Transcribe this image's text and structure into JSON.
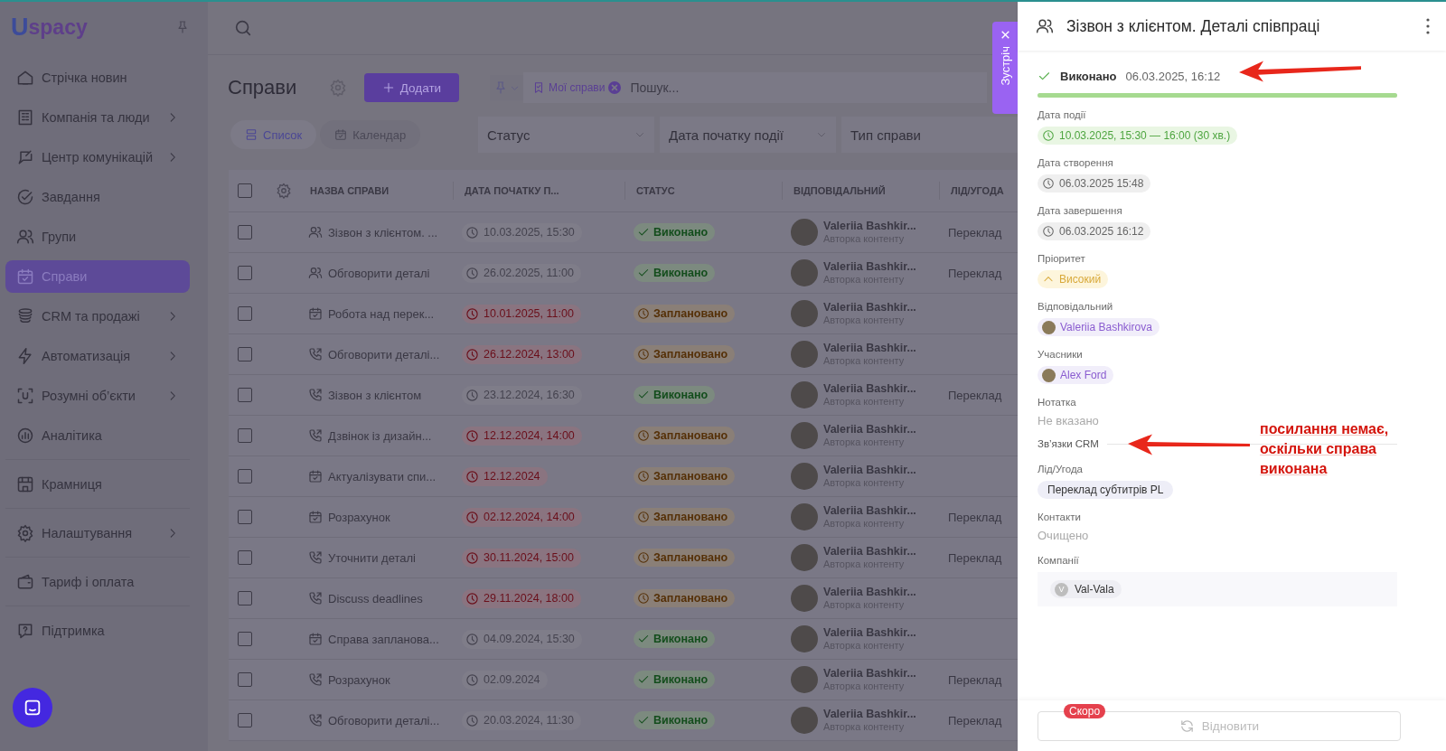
{
  "sidebar": {
    "logo": {
      "letter": "U",
      "text": "spacy"
    },
    "groups": [
      [
        {
          "label": "Стрічка новин",
          "submenu": false,
          "selected": false
        },
        {
          "label": "Компанія та люди",
          "submenu": true,
          "selected": false
        },
        {
          "label": "Центр комунікацій",
          "submenu": true,
          "selected": false
        },
        {
          "label": "Завдання",
          "submenu": false,
          "selected": false
        },
        {
          "label": "Групи",
          "submenu": false,
          "selected": false
        },
        {
          "label": "Справи",
          "submenu": false,
          "selected": true
        },
        {
          "label": "CRM та продажі",
          "submenu": true,
          "selected": false
        },
        {
          "label": "Автоматизація",
          "submenu": true,
          "selected": false
        },
        {
          "label": "Розумні об’єкти",
          "submenu": true,
          "selected": false
        },
        {
          "label": "Аналітика",
          "submenu": false,
          "selected": false
        }
      ],
      [
        {
          "label": "Крамниця",
          "submenu": false,
          "selected": false
        }
      ],
      [
        {
          "label": "Налаштування",
          "submenu": true,
          "selected": false
        }
      ],
      [
        {
          "label": "Тариф і оплата",
          "submenu": false,
          "selected": false
        }
      ],
      [
        {
          "label": "Підтримка",
          "submenu": false,
          "selected": false
        }
      ]
    ]
  },
  "page": {
    "title": "Справи",
    "add_button": "Додати",
    "filter_chip": "Мої справи",
    "search_placeholder": "Пошук...",
    "view_tabs": [
      {
        "label": "Список",
        "selected": true
      },
      {
        "label": "Календар",
        "selected": false
      }
    ],
    "filters": [
      {
        "label": "Статус",
        "dropdown": true
      },
      {
        "label": "Дата початку події",
        "dropdown": true
      },
      {
        "label": "Тип справи",
        "dropdown": false
      }
    ]
  },
  "table": {
    "all_checked": false,
    "columns": [
      "НАЗВА СПРАВИ",
      "ДАТА ПОЧАТКУ П...",
      "СТАТУС",
      "ВІДПОВІДАЛЬНИЙ",
      "ЛІД/УГОДА"
    ],
    "rows": [
      {
        "checked": false,
        "kind": "meeting",
        "name": "Зізвон з клієнтом. ...",
        "date": "10.03.2025, 15:30",
        "overdue": false,
        "status": "Виконано",
        "done": true,
        "person": "Valeriia Bashkir...",
        "role": "Авторка контенту",
        "lead": "Переклад"
      },
      {
        "checked": false,
        "kind": "meeting",
        "name": "Обговорити деталі",
        "date": "26.02.2025, 11:00",
        "overdue": false,
        "status": "Виконано",
        "done": true,
        "person": "Valeriia Bashkir...",
        "role": "Авторка контенту",
        "lead": "Переклад"
      },
      {
        "checked": false,
        "kind": "task",
        "name": "Робота над перек...",
        "date": "10.01.2025, 11:00",
        "overdue": true,
        "status": "Заплановано",
        "done": false,
        "person": "Valeriia Bashkir...",
        "role": "Авторка контенту"
      },
      {
        "checked": false,
        "kind": "call",
        "name": "Обговорити деталі...",
        "date": "26.12.2024, 13:00",
        "overdue": true,
        "status": "Заплановано",
        "done": false,
        "person": "Valeriia Bashkir...",
        "role": "Авторка контенту"
      },
      {
        "checked": false,
        "kind": "call",
        "name": "Зізвон з клієнтом",
        "date": "23.12.2024, 16:30",
        "overdue": false,
        "status": "Виконано",
        "done": true,
        "person": "Valeriia Bashkir...",
        "role": "Авторка контенту",
        "lead": "Переклад"
      },
      {
        "checked": false,
        "kind": "call",
        "name": "Дзвінок із дизайн...",
        "date": "12.12.2024, 14:00",
        "overdue": true,
        "status": "Заплановано",
        "done": false,
        "person": "Valeriia Bashkir...",
        "role": "Авторка контенту"
      },
      {
        "checked": false,
        "kind": "task",
        "name": "Актуалізувати спи...",
        "date": "12.12.2024",
        "overdue": true,
        "status": "Заплановано",
        "done": false,
        "person": "Valeriia Bashkir...",
        "role": "Авторка контенту"
      },
      {
        "checked": false,
        "kind": "task",
        "name": "Розрахунок",
        "date": "02.12.2024, 14:00",
        "overdue": true,
        "status": "Заплановано",
        "done": false,
        "person": "Valeriia Bashkir...",
        "role": "Авторка контенту",
        "lead": "Переклад"
      },
      {
        "checked": false,
        "kind": "call",
        "name": "Уточнити деталі",
        "date": "30.11.2024, 15:00",
        "overdue": true,
        "status": "Заплановано",
        "done": false,
        "person": "Valeriia Bashkir...",
        "role": "Авторка контенту",
        "lead": "Переклад"
      },
      {
        "checked": false,
        "kind": "call",
        "name": "Discuss deadlines",
        "date": "29.11.2024, 18:00",
        "overdue": true,
        "status": "Заплановано",
        "done": false,
        "person": "Valeriia Bashkir...",
        "role": "Авторка контенту"
      },
      {
        "checked": false,
        "kind": "task",
        "name": "Справа запланова...",
        "date": "04.09.2024, 15:30",
        "overdue": false,
        "status": "Виконано",
        "done": true,
        "person": "Valeriia Bashkir...",
        "role": "Авторка контенту"
      },
      {
        "checked": false,
        "kind": "call",
        "name": "Розрахунок",
        "date": "02.09.2024",
        "overdue": false,
        "status": "Виконано",
        "done": true,
        "person": "Valeriia Bashkir...",
        "role": "Авторка контенту",
        "lead": "Переклад"
      },
      {
        "checked": false,
        "kind": "call",
        "name": "Обговорити деталі...",
        "date": "20.03.2024, 11:30",
        "overdue": false,
        "status": "Виконано",
        "done": true,
        "person": "Valeriia Bashkir...",
        "role": "Авторка контенту",
        "lead": "Переклад"
      }
    ]
  },
  "meeting_tab": {
    "label": "Зустріч"
  },
  "drawer": {
    "title": "Зізвон з клієнтом. Деталі співпраці",
    "status": {
      "label": "Виконано",
      "time": "06.03.2025, 16:12",
      "level": 1
    },
    "fields": [
      {
        "kind": "date",
        "label": "Дата події",
        "value": "10.03.2025, 15:30 — 16:00 (30 хв.)",
        "highlighted": true
      },
      {
        "kind": "date",
        "label": "Дата створення",
        "value": "06.03.2025 15:48",
        "highlighted": false
      },
      {
        "kind": "date",
        "label": "Дата завершення",
        "value": "06.03.2025 16:12",
        "highlighted": false
      },
      {
        "kind": "priority",
        "label": "Пріоритет",
        "value": "Високий"
      },
      {
        "kind": "person",
        "label": "Відповідальний",
        "value": "Valeriia Bashkirova"
      },
      {
        "kind": "person",
        "label": "Учасники",
        "value": "Alex Ford"
      },
      {
        "kind": "empty",
        "label": "Нотатка",
        "value": "Не вказано"
      },
      {
        "kind": "section",
        "label": "Зв’язки CRM"
      },
      {
        "kind": "tag",
        "label": "Лід/Угода",
        "value": "Переклад субтитрів PL"
      },
      {
        "kind": "empty",
        "label": "Контакти",
        "value": "Очищено"
      },
      {
        "kind": "company",
        "label": "Компанії",
        "value": "Val-Vala",
        "initial": "V"
      }
    ],
    "footer": {
      "button": "Відновити",
      "disabled": true,
      "badge": "Скоро"
    }
  },
  "annotation": {
    "note": "посилання немає, оскільки справа виконана"
  }
}
